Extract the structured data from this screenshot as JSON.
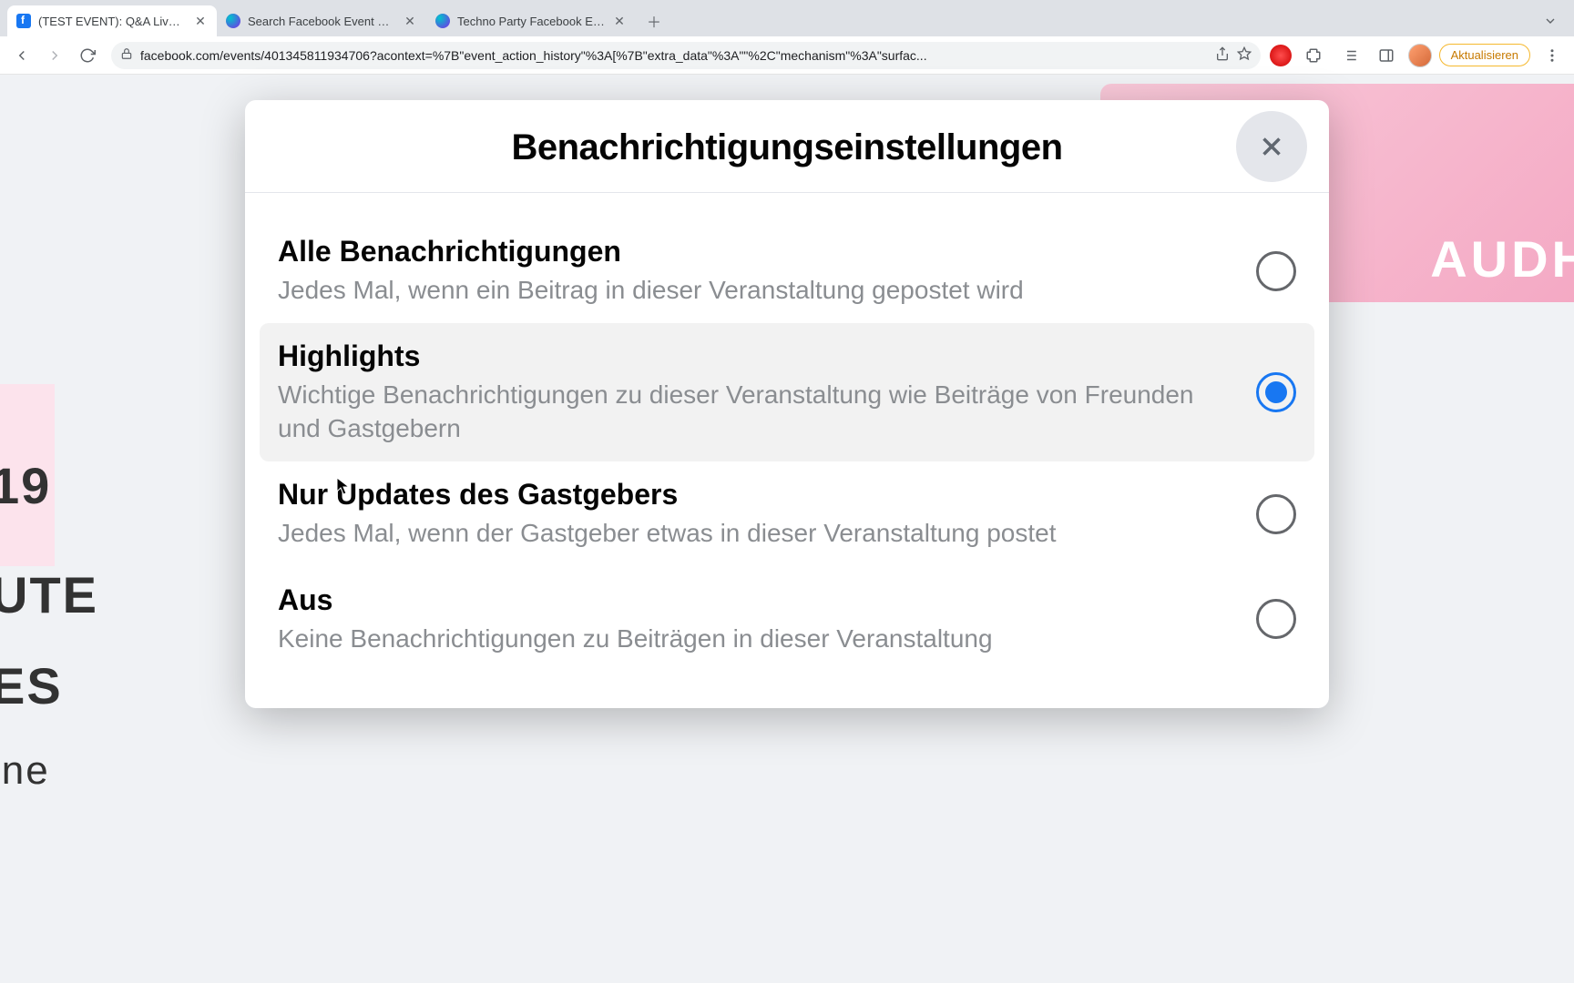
{
  "browser": {
    "tabs": [
      {
        "title": "(TEST EVENT): Q&A Livestream",
        "favicon": "fb",
        "active": true
      },
      {
        "title": "Search Facebook Event Cover",
        "favicon": "canva",
        "active": false
      },
      {
        "title": "Techno Party Facebook Event C",
        "favicon": "canva",
        "active": false
      }
    ],
    "url": "facebook.com/events/401345811934706?acontext=%7B\"event_action_history\"%3A[%7B\"extra_data\"%3A\"\"%2C\"mechanism\"%3A\"surfac...",
    "update_label": "Aktualisieren"
  },
  "background": {
    "right_brand": "AUDH",
    "left_text_1": "19",
    "left_text_2": "UTE",
    "left_text_3": "ES",
    "left_text_4": "ine"
  },
  "modal": {
    "title": "Benachrichtigungseinstellungen",
    "options": [
      {
        "title": "Alle Benachrichtigungen",
        "desc": "Jedes Mal, wenn ein Beitrag in dieser Veranstaltung gepostet wird",
        "selected": false,
        "hover": false
      },
      {
        "title": "Highlights",
        "desc": "Wichtige Benachrichtigungen zu dieser Veranstaltung wie Beiträge von Freunden und Gastgebern",
        "selected": true,
        "hover": true
      },
      {
        "title": "Nur Updates des Gastgebers",
        "desc": "Jedes Mal, wenn der Gastgeber etwas in dieser Veranstaltung postet",
        "selected": false,
        "hover": false
      },
      {
        "title": "Aus",
        "desc": "Keine Benachrichtigungen zu Beiträgen in dieser Veranstaltung",
        "selected": false,
        "hover": false
      }
    ]
  }
}
